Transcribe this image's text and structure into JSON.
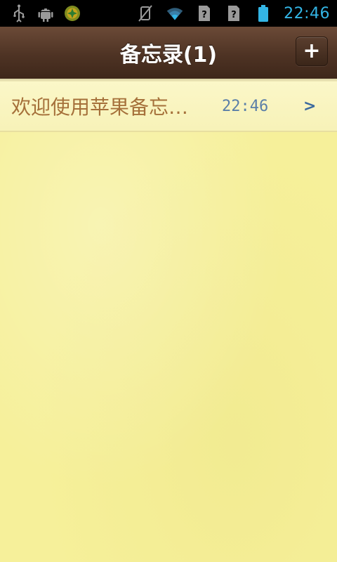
{
  "status_bar": {
    "left_icons": [
      "usb-icon",
      "android-debug-icon",
      "app-notification-icon"
    ],
    "right_icons": [
      "vibrate-off-icon",
      "wifi-icon",
      "no-sim-icon-1",
      "no-sim-icon-2",
      "battery-icon"
    ],
    "time": "22:46",
    "time_color": "#33b5e5"
  },
  "header": {
    "title": "备忘录(1)",
    "add_label": "+",
    "background": "#4e3324"
  },
  "notes": [
    {
      "title": "欢迎使用苹果备忘…",
      "time": "22:46",
      "chevron": ">"
    }
  ],
  "colors": {
    "paper": "#f6f09a",
    "note_title": "#a5703a",
    "note_time": "#5b7fa8"
  }
}
